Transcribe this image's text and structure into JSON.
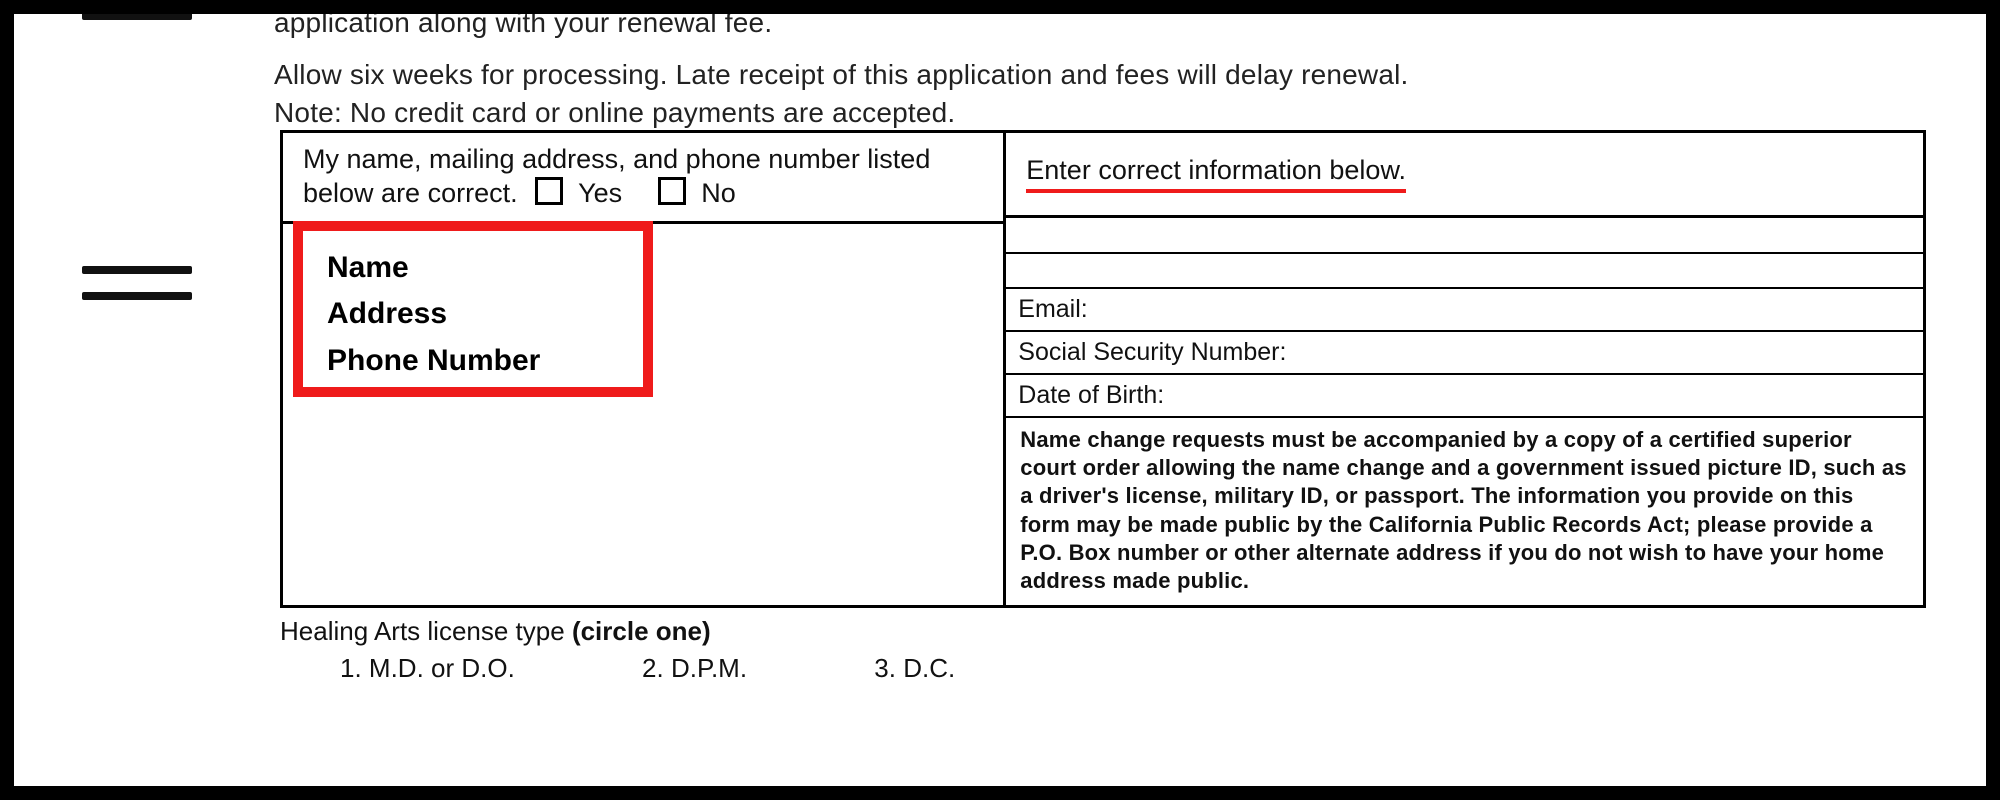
{
  "intro": {
    "line1": "application along with your renewal fee.",
    "line2": "Allow six weeks for processing. Late receipt of this application and fees will delay renewal.",
    "line3": "Note: No credit card or online payments are accepted."
  },
  "leftHeader": {
    "text1": "My name, mailing address, and phone number listed",
    "text2a": "below are correct.",
    "yes": "Yes",
    "no": "No"
  },
  "redBox": {
    "l1": "Name",
    "l2": "Address",
    "l3": "Phone Number"
  },
  "rightHeader": "Enter correct information below.",
  "rightRows": {
    "email": "Email:",
    "ssn": "Social Security Number:",
    "dob": "Date of Birth:"
  },
  "note": "Name change requests must be accompanied by a copy of a certified superior court order allowing the name change and a government issued picture ID, such as a driver's license, military ID, or passport. The information you provide on this form may be made public by the California Public Records Act; please provide a P.O. Box number or other alternate address if you do not wish to have your home address made public.",
  "license": {
    "label": "Healing Arts license type ",
    "circle": "(circle one)",
    "opt1": "1.  M.D. or D.O.",
    "opt2": "2.  D.P.M.",
    "opt3": "3.  D.C."
  }
}
